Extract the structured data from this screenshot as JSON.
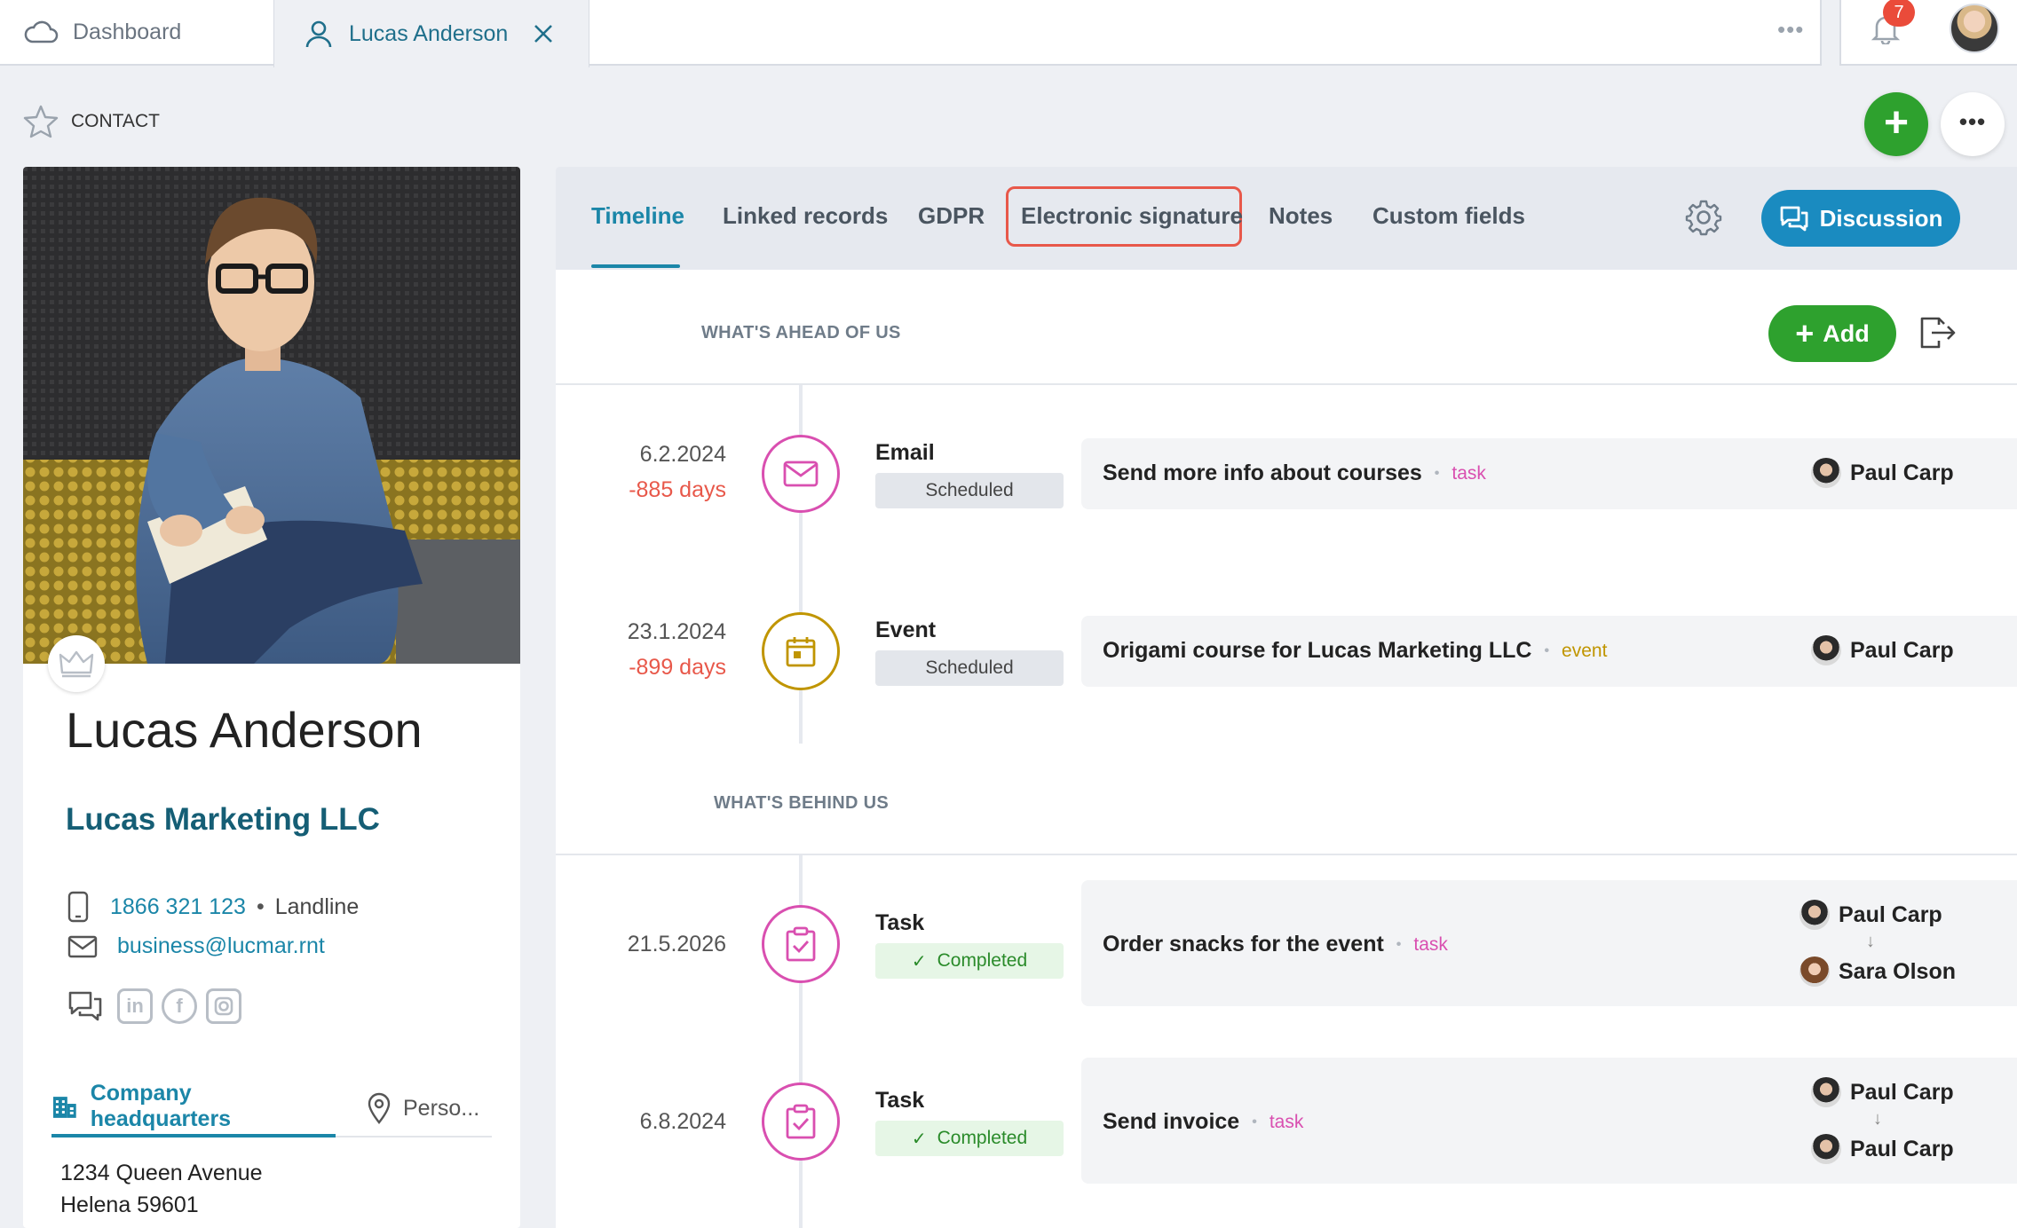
{
  "tabs": {
    "dashboard_label": "Dashboard",
    "contact_tab_label": "Lucas Anderson",
    "more": "•••",
    "notification_count": "7"
  },
  "header": {
    "section": "CONTACT",
    "add": "+",
    "more": "•••"
  },
  "contact": {
    "name": "Lucas Anderson",
    "company": "Lucas Marketing LLC",
    "phone": "1866 321 123",
    "phone_sep": "•",
    "phone_type": "Landline",
    "email": "business@lucmar.rnt",
    "social": {
      "linkedin": "in",
      "facebook": "f"
    },
    "address_tabs": [
      "Company headquarters",
      "Perso..."
    ],
    "address_line1": "1234 Queen Avenue",
    "address_line2": "Helena 59601"
  },
  "panel": {
    "tabs": [
      "Timeline",
      "Linked records",
      "GDPR",
      "Electronic signature",
      "Notes",
      "Custom fields"
    ],
    "discussion": "Discussion",
    "ahead_label": "WHAT'S AHEAD OF US",
    "behind_label": "WHAT'S BEHIND US",
    "add": "Add",
    "add_plus": "+"
  },
  "timeline": {
    "ahead": [
      {
        "date": "6.2.2024",
        "days": "-885 days",
        "kind": "Email",
        "status": "Scheduled",
        "title": "Send more info about courses",
        "sep": "•",
        "tag": "task",
        "person": "Paul Carp"
      },
      {
        "date": "23.1.2024",
        "days": "-899 days",
        "kind": "Event",
        "status": "Scheduled",
        "title": "Origami course for Lucas Marketing LLC",
        "sep": "•",
        "tag": "event",
        "person": "Paul Carp"
      }
    ],
    "behind": [
      {
        "date": "21.5.2026",
        "kind": "Task",
        "status_check": "✓",
        "status": "Completed",
        "title": "Order snacks for the event",
        "sep": "•",
        "tag": "task",
        "from": "Paul Carp",
        "arrow": "↓",
        "to": "Sara Olson"
      },
      {
        "date": "6.8.2024",
        "kind": "Task",
        "status_check": "✓",
        "status": "Completed",
        "title": "Send invoice",
        "sep": "•",
        "tag": "task",
        "from": "Paul Carp",
        "arrow": "↓",
        "to": "Paul Carp"
      }
    ]
  },
  "colors": {
    "accent": "#1b86a8",
    "green": "#2ea12e",
    "red": "#e8584a",
    "task": "#d94fb0",
    "event": "#c09500"
  }
}
